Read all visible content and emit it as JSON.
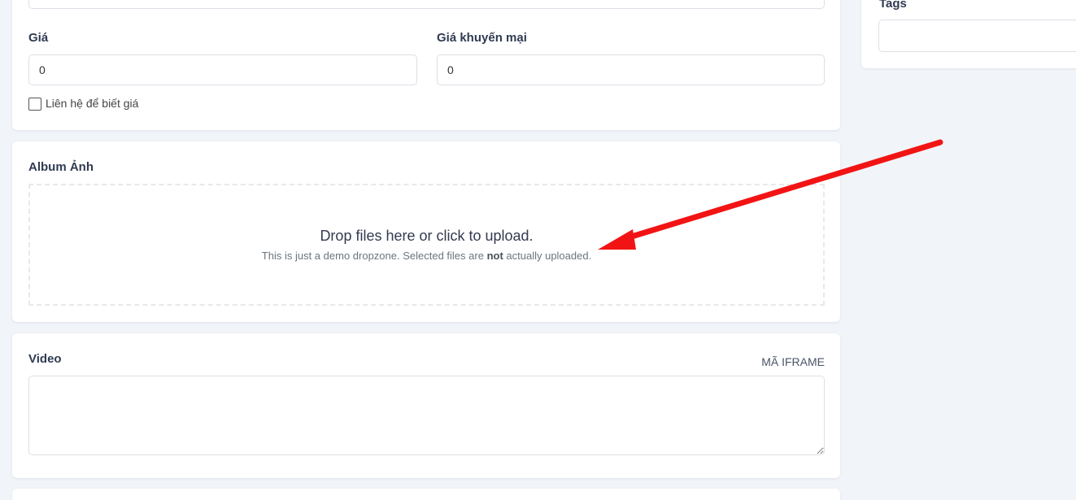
{
  "price": {
    "label": "Giá",
    "value": "0"
  },
  "sale_price": {
    "label": "Giá khuyến mại",
    "value": "0"
  },
  "contact_checkbox": {
    "label": "Liên hệ để biết giá",
    "checked": false
  },
  "album": {
    "title": "Album Ảnh",
    "dropzone_title": "Drop files here or click to upload.",
    "dropzone_sub_before": "This is just a demo dropzone. Selected files are ",
    "dropzone_sub_bold": "not",
    "dropzone_sub_after": " actually uploaded."
  },
  "video": {
    "title": "Video",
    "hint": "MÃ IFRAME",
    "value": ""
  },
  "tags": {
    "label": "Tags",
    "value": ""
  },
  "colors": {
    "annotation_arrow": "#f21414",
    "page_bg": "#f1f4f9"
  }
}
